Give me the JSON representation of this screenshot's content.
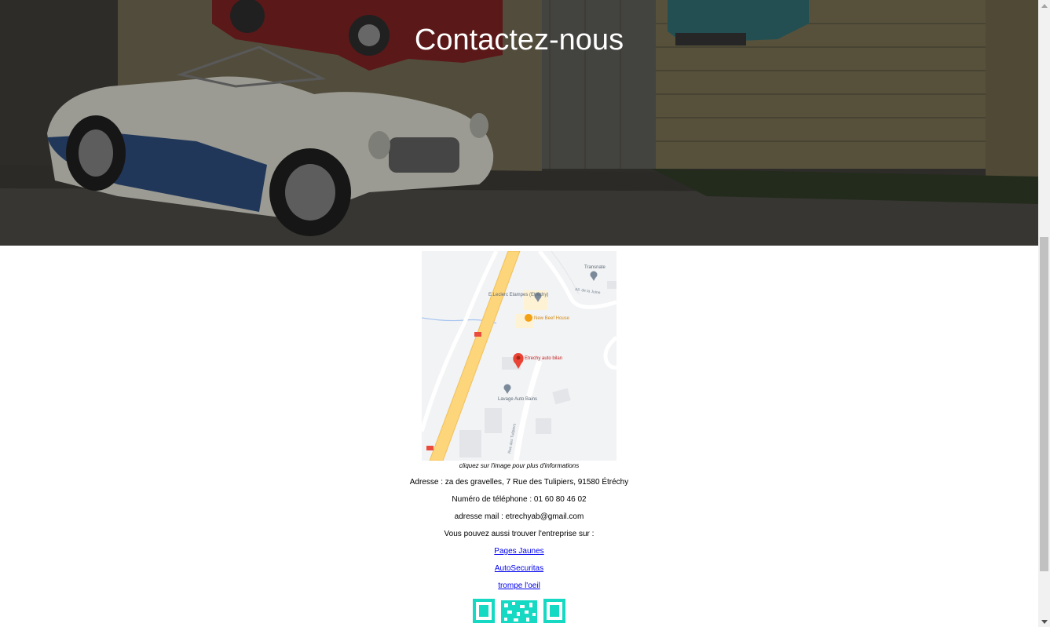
{
  "hero": {
    "title": "Contactez-nous"
  },
  "map": {
    "labels": {
      "transnate": "Transnate",
      "leclerc": "E.Leclerc Etampes (Etréchy)",
      "restaurant": "New Beef House",
      "business": "Etrechy auto bilan",
      "lavage": "Lavage Auto Bains",
      "street1": "All. de la Juine",
      "street2": "Rue des Tulipiers",
      "road": "N20"
    }
  },
  "contact": {
    "caption": "cliquez sur l'image pour plus d'informations",
    "address": "Adresse : za des gravelles, 7 Rue des Tulipiers, 91580 Étréchy",
    "phone": "Numéro de téléphone : 01 60 80 46 02",
    "email": "adresse mail : etrechyab@gmail.com",
    "find_us": "Vous pouvez aussi trouver l'entreprise sur :"
  },
  "links": {
    "pages_jaunes": "Pages Jaunes",
    "autosecuritas": "AutoSecuritas",
    "trompe_loeil": "trompe l'oeil"
  },
  "colors": {
    "link": "#0000ee",
    "qr": "#16d9c3",
    "map_road": "#fdd57a",
    "map_pin": "#ea4335"
  }
}
